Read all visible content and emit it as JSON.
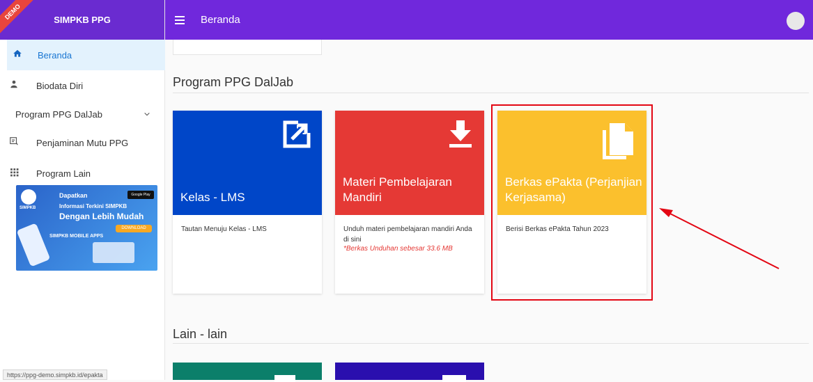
{
  "app": {
    "brand": "SIMPKB PPG",
    "demo_label": "DEMO",
    "page_title": "Beranda"
  },
  "sidebar": {
    "items": [
      {
        "label": "Beranda",
        "icon": "home-icon"
      },
      {
        "label": "Biodata Diri",
        "icon": "person-icon"
      },
      {
        "label": "Program PPG DalJab",
        "icon": "chevron-down-icon"
      },
      {
        "label": "Penjaminan Mutu PPG",
        "icon": "rating-icon"
      },
      {
        "label": "Program Lain",
        "icon": "apps-grid-icon"
      }
    ]
  },
  "promo": {
    "logo_text": "SIMPKB",
    "line1": "Dapatkan",
    "line2": "Informasi Terkini SIMPKB",
    "line3": "Dengan Lebih Mudah",
    "store_label": "Google Play",
    "download_label": "DOWNLOAD",
    "apps_label": "SIMPKB MOBILE APPS"
  },
  "sections": [
    {
      "title": "Program PPG DalJab"
    },
    {
      "title": "Lain - lain"
    }
  ],
  "cards": [
    {
      "title": "Kelas - LMS",
      "desc": "Tautan Menuju Kelas - LMS",
      "note": "",
      "color": "#0046c8",
      "icon": "open-external-icon"
    },
    {
      "title": "Materi Pembelajaran Mandiri",
      "desc": "Unduh materi pembelajaran mandiri Anda di sini",
      "note": "*Berkas Unduhan sebesar 33.6 MB",
      "color": "#e53935",
      "icon": "download-icon"
    },
    {
      "title": "Berkas ePakta (Perjanjian Kerjasama)",
      "desc": "Berisi Berkas ePakta Tahun 2023",
      "note": "",
      "color": "#fbc02d",
      "icon": "file-copy-icon"
    }
  ],
  "status_url": "https://ppg-demo.simpkb.id/epakta",
  "colors": {
    "topbar": "#7028dc",
    "brand": "#6a2bd0",
    "highlight": "#e30613",
    "annotation_arrow": "#e30613"
  }
}
